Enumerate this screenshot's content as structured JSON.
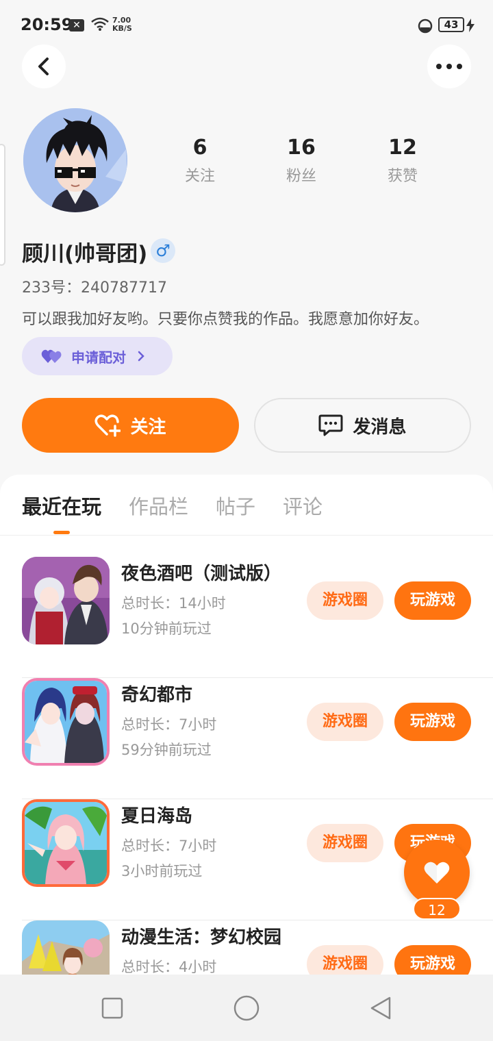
{
  "status_bar": {
    "time": "20:59",
    "speed_value": "7.00",
    "speed_unit": "KB/S",
    "battery": "43"
  },
  "profile": {
    "stats": [
      {
        "value": "6",
        "label": "关注"
      },
      {
        "value": "16",
        "label": "粉丝"
      },
      {
        "value": "12",
        "label": "获赞"
      }
    ],
    "name": "顾川(帅哥团)",
    "gender_symbol": "♂",
    "uid": "233号：240787717",
    "bio": "可以跟我加好友哟。只要你点赞我的作品。我愿意加你好友。",
    "match_label": "申请配对"
  },
  "actions": {
    "follow_label": "关注",
    "message_label": "发消息"
  },
  "tabs": [
    {
      "label": "最近在玩",
      "active": true
    },
    {
      "label": "作品栏",
      "active": false
    },
    {
      "label": "帖子",
      "active": false
    },
    {
      "label": "评论",
      "active": false
    }
  ],
  "games": [
    {
      "title": "夜色酒吧（测试版）",
      "duration": "总时长：14小时",
      "last_played": "10分钟前玩过",
      "circle_label": "游戏圈",
      "play_label": "玩游戏"
    },
    {
      "title": "奇幻都市",
      "duration": "总时长：7小时",
      "last_played": "59分钟前玩过",
      "circle_label": "游戏圈",
      "play_label": "玩游戏"
    },
    {
      "title": "夏日海岛",
      "duration": "总时长：7小时",
      "last_played": "3小时前玩过",
      "circle_label": "游戏圈",
      "play_label": "玩游戏"
    },
    {
      "title": "动漫生活：梦幻校园",
      "duration": "总时长：4小时",
      "last_played": "",
      "circle_label": "游戏圈",
      "play_label": "玩游戏"
    }
  ],
  "floating_like": {
    "count": "12"
  },
  "colors": {
    "accent": "#ff7a10",
    "match_purple": "#6b5fd8",
    "circle_bg": "#fde8dd"
  },
  "icons": [
    "back-icon",
    "more-icon",
    "heart-icon",
    "heart-plus-icon",
    "chat-icon",
    "chevron-right-icon",
    "square-nav-icon",
    "circle-nav-icon",
    "triangle-back-nav-icon"
  ]
}
